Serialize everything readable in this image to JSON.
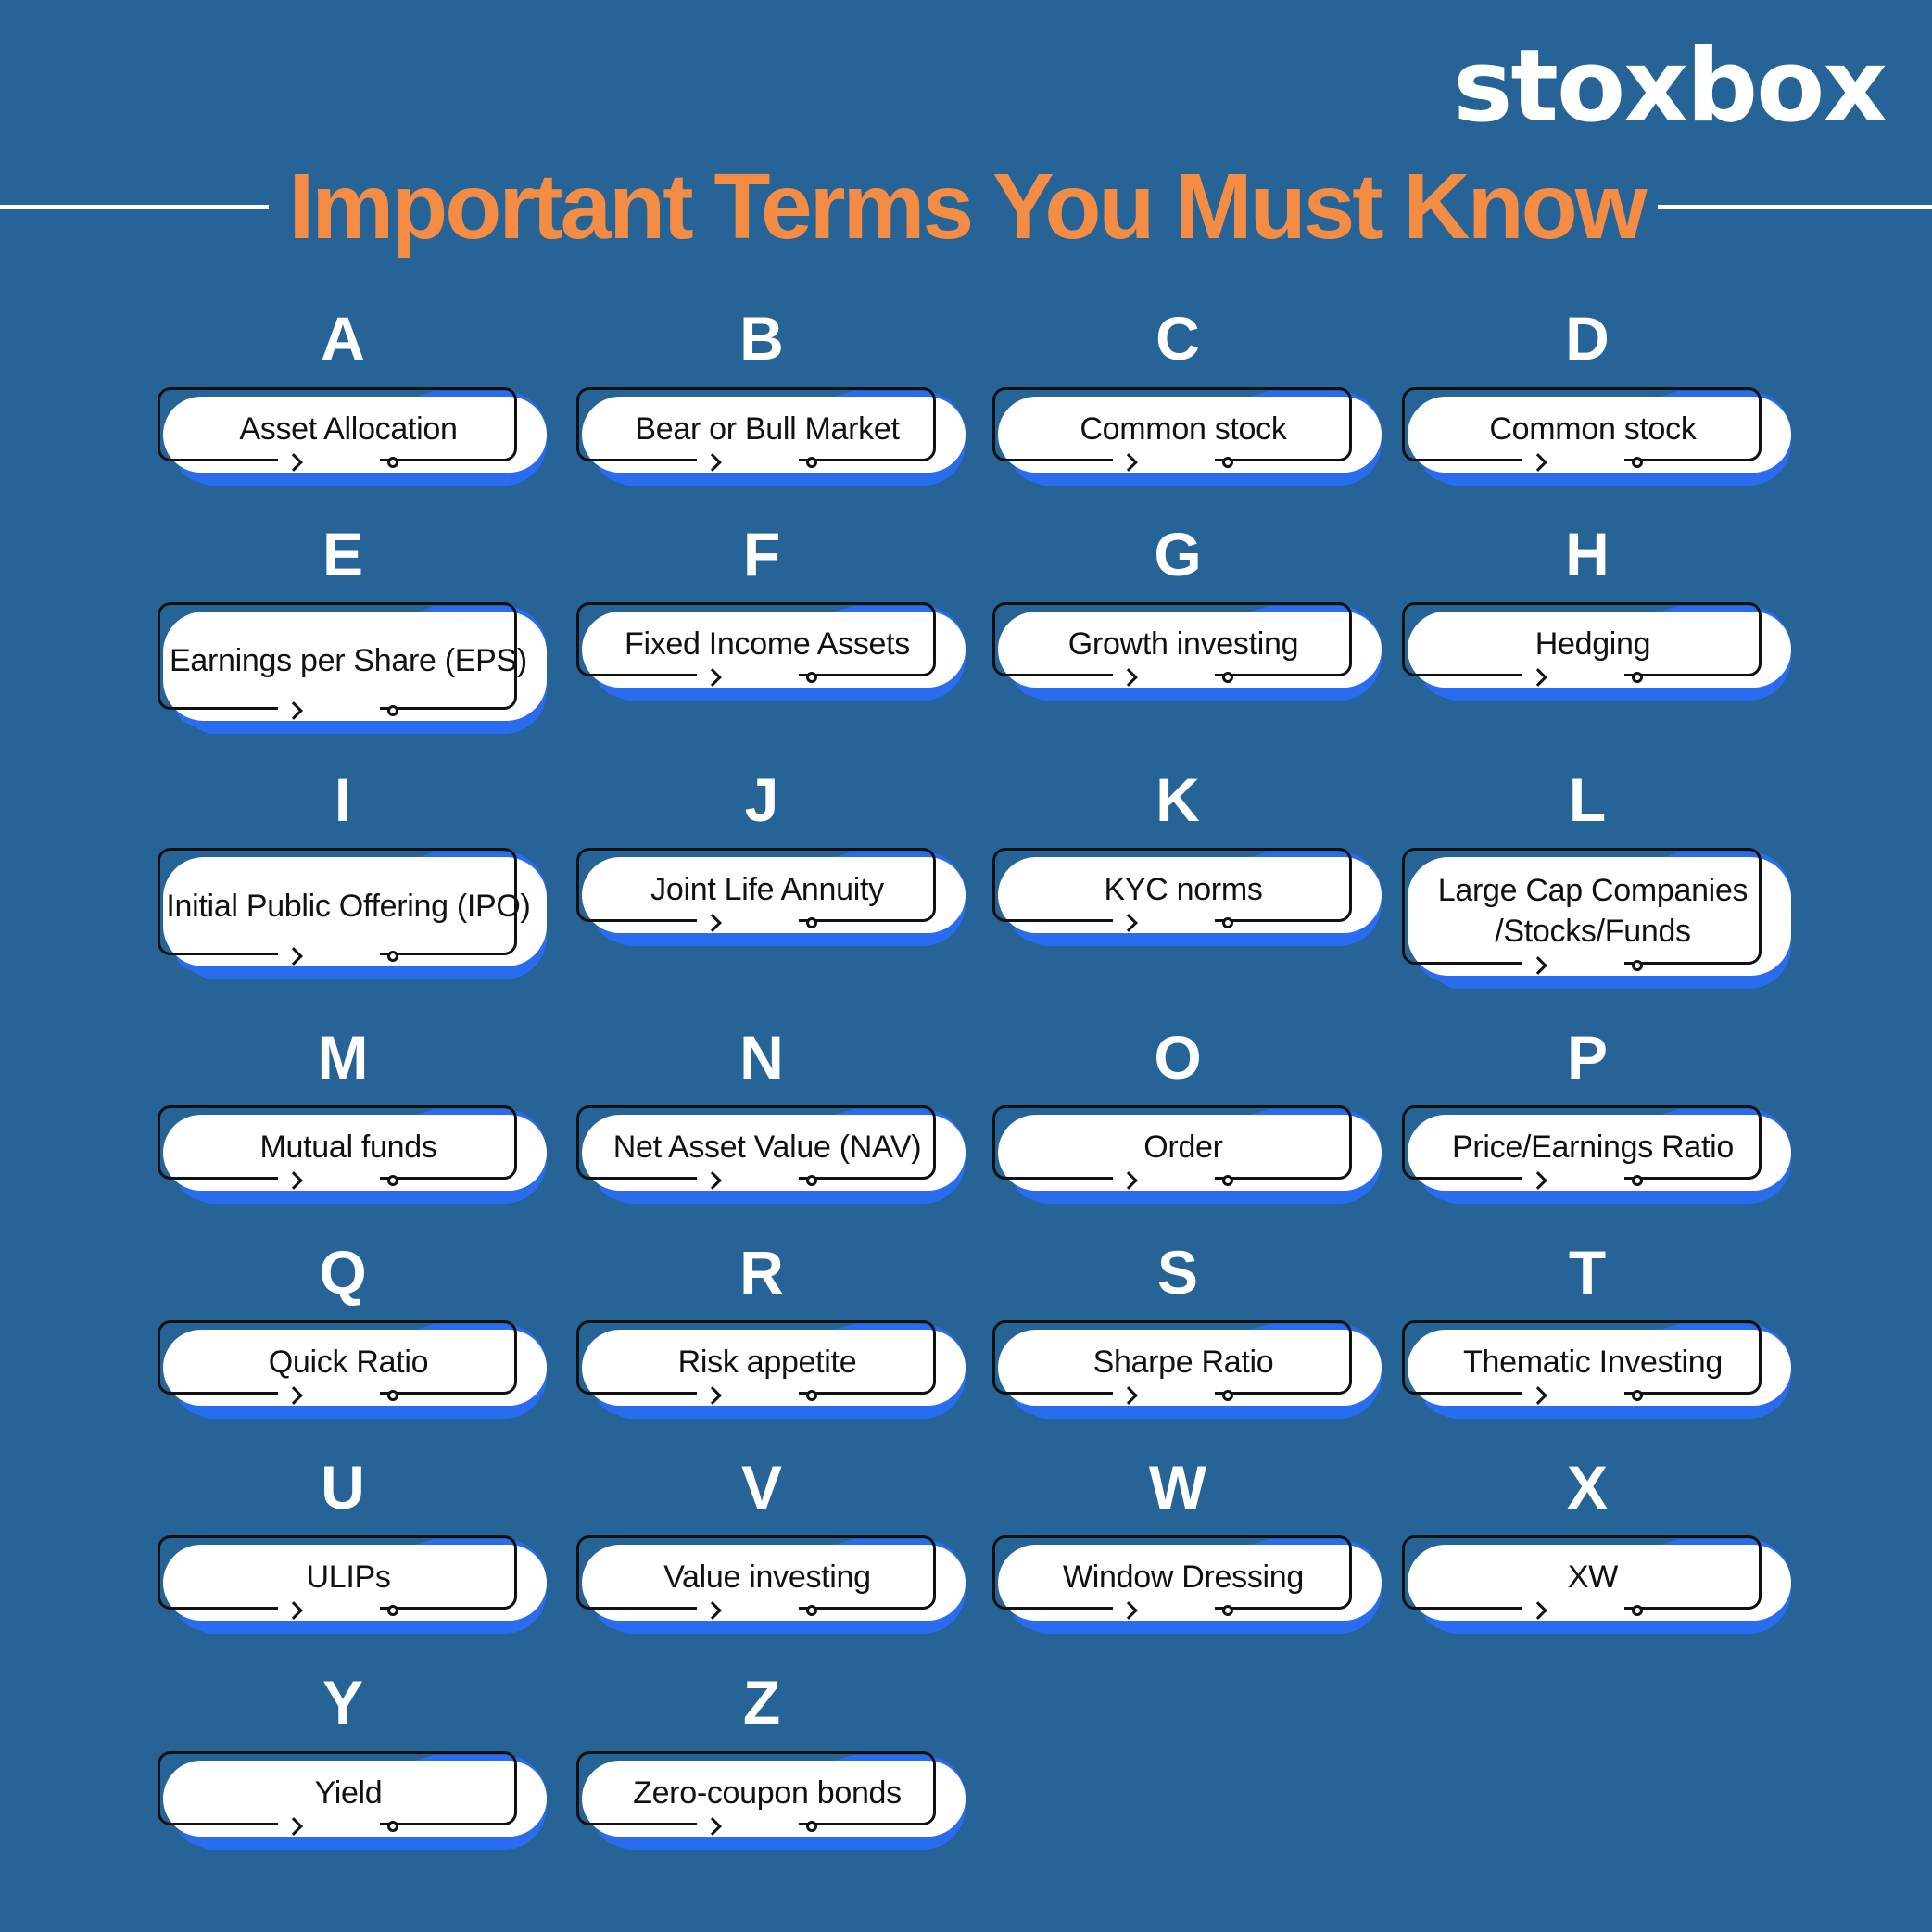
{
  "brand": {
    "logo_text": "stoxbox"
  },
  "header": {
    "title": "Important Terms You Must Know"
  },
  "colors": {
    "background": "#266497",
    "title": "#f58c44",
    "accent_blue": "#2a6cf0",
    "card": "#ffffff"
  },
  "terms": [
    {
      "letter": "A",
      "term": "Asset Allocation"
    },
    {
      "letter": "B",
      "term": "Bear or Bull Market"
    },
    {
      "letter": "C",
      "term": "Common stock"
    },
    {
      "letter": "D",
      "term": "Common stock"
    },
    {
      "letter": "E",
      "term": "Earnings per Share (EPS)"
    },
    {
      "letter": "F",
      "term": "Fixed Income Assets"
    },
    {
      "letter": "G",
      "term": "Growth investing"
    },
    {
      "letter": "H",
      "term": "Hedging"
    },
    {
      "letter": "I",
      "term": "Initial Public Offering (IPO)"
    },
    {
      "letter": "J",
      "term": "Joint Life Annuity"
    },
    {
      "letter": "K",
      "term": "KYC norms"
    },
    {
      "letter": "L",
      "term": "Large Cap Companies /Stocks/Funds"
    },
    {
      "letter": "M",
      "term": "Mutual funds"
    },
    {
      "letter": "N",
      "term": "Net Asset Value (NAV)"
    },
    {
      "letter": "O",
      "term": "Order"
    },
    {
      "letter": "P",
      "term": "Price/Earnings Ratio"
    },
    {
      "letter": "Q",
      "term": "Quick Ratio"
    },
    {
      "letter": "R",
      "term": "Risk appetite"
    },
    {
      "letter": "S",
      "term": "Sharpe Ratio"
    },
    {
      "letter": "T",
      "term": "Thematic Investing"
    },
    {
      "letter": "U",
      "term": "ULIPs"
    },
    {
      "letter": "V",
      "term": "Value investing"
    },
    {
      "letter": "W",
      "term": "Window Dressing"
    },
    {
      "letter": "X",
      "term": "XW"
    },
    {
      "letter": "Y",
      "term": "Yield"
    },
    {
      "letter": "Z",
      "term": "Zero-coupon bonds"
    }
  ]
}
